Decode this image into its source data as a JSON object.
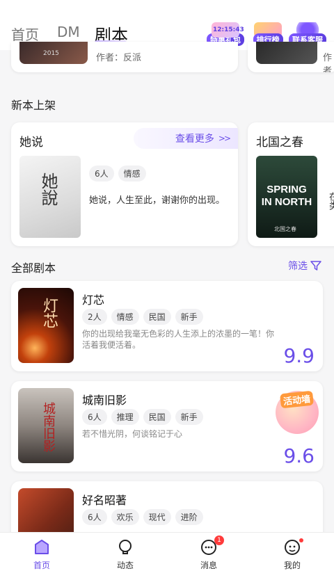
{
  "header": {
    "tabs": [
      "首页",
      "DM",
      "剧本"
    ],
    "badges": [
      {
        "top": "12:15:43",
        "label": "特惠礼包"
      },
      {
        "label": "排行榜"
      },
      {
        "label": "联系客服"
      }
    ]
  },
  "top_partial": {
    "author_text": "作者：反派",
    "cover_text": "2015",
    "right_author_text": "作者"
  },
  "new_releases": {
    "section_title": "新本上架",
    "cards": [
      {
        "title": "她说",
        "more": "查看更多",
        "tags": [
          "6人",
          "情感"
        ],
        "description": "她说，人生至此，谢谢你的出现。",
        "cover_text": "她說"
      },
      {
        "title": "北国之春",
        "cover_text": "SPRING IN NORTH",
        "cover_sub": "北国之春",
        "side_text": "在类"
      }
    ]
  },
  "all_scripts": {
    "section_title": "全部剧本",
    "filter_label": "筛选",
    "items": [
      {
        "title": "灯芯",
        "tags": [
          "2人",
          "情感",
          "民国",
          "新手"
        ],
        "description": "你的出现给我毫无色彩的人生添上的浓墨的一笔！你活着我便活着。",
        "score": "9.9",
        "cover_text": "灯芯"
      },
      {
        "title": "城南旧影",
        "tags": [
          "6人",
          "推理",
          "民国",
          "新手"
        ],
        "description": "若不惜光阴，何谈铭记于心",
        "score": "9.6",
        "badge": "活动墙",
        "cover_text": "城南旧影"
      },
      {
        "title": "好名昭著",
        "tags": [
          "6人",
          "欢乐",
          "现代",
          "进阶"
        ],
        "description": "",
        "score": ""
      }
    ]
  },
  "bottom_nav": {
    "items": [
      {
        "label": "首页",
        "active": true
      },
      {
        "label": "动态"
      },
      {
        "label": "消息",
        "badge": "1"
      },
      {
        "label": "我的",
        "dot": true
      }
    ]
  },
  "colors": {
    "accent": "#6a4ee8",
    "badge_red": "#ff3b3b"
  }
}
